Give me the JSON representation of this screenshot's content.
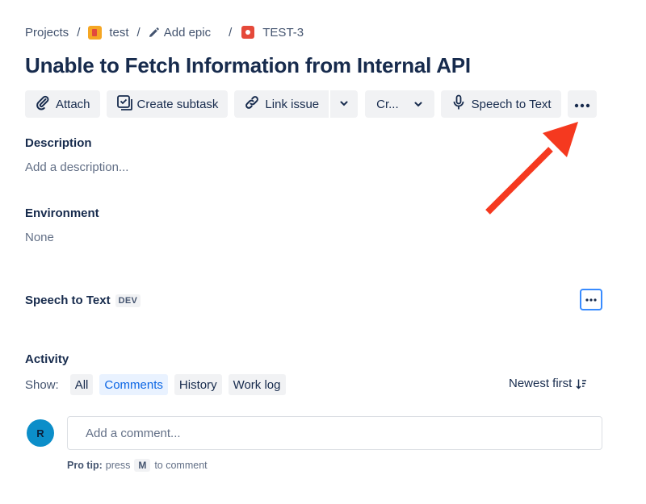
{
  "breadcrumb": {
    "projects": "Projects",
    "project": "test",
    "epic": "Add epic",
    "issue_key": "TEST-3",
    "separator": "/"
  },
  "issue": {
    "title": "Unable to Fetch Information from Internal API"
  },
  "toolbar": {
    "attach": "Attach",
    "create_subtask": "Create subtask",
    "link_issue": "Link issue",
    "create_truncated": "Cr...",
    "speech_to_text": "Speech to Text"
  },
  "description": {
    "label": "Description",
    "placeholder": "Add a description..."
  },
  "environment": {
    "label": "Environment",
    "value": "None"
  },
  "speech_panel": {
    "label": "Speech to Text",
    "badge": "DEV"
  },
  "activity": {
    "label": "Activity",
    "show_label": "Show:",
    "filters": [
      "All",
      "Comments",
      "History",
      "Work log"
    ],
    "active_filter": "Comments",
    "sort": "Newest first"
  },
  "comment": {
    "avatar_initial": "R",
    "placeholder": "Add a comment...",
    "protip_label": "Pro tip:",
    "protip_press": "press",
    "protip_key": "M",
    "protip_suffix": "to comment"
  },
  "colors": {
    "accent": "#0c66e4",
    "annotation_arrow": "#f5391f",
    "project_icon": "#f5a623",
    "issue_icon": "#e5493a",
    "avatar": "#0c8ec9"
  }
}
